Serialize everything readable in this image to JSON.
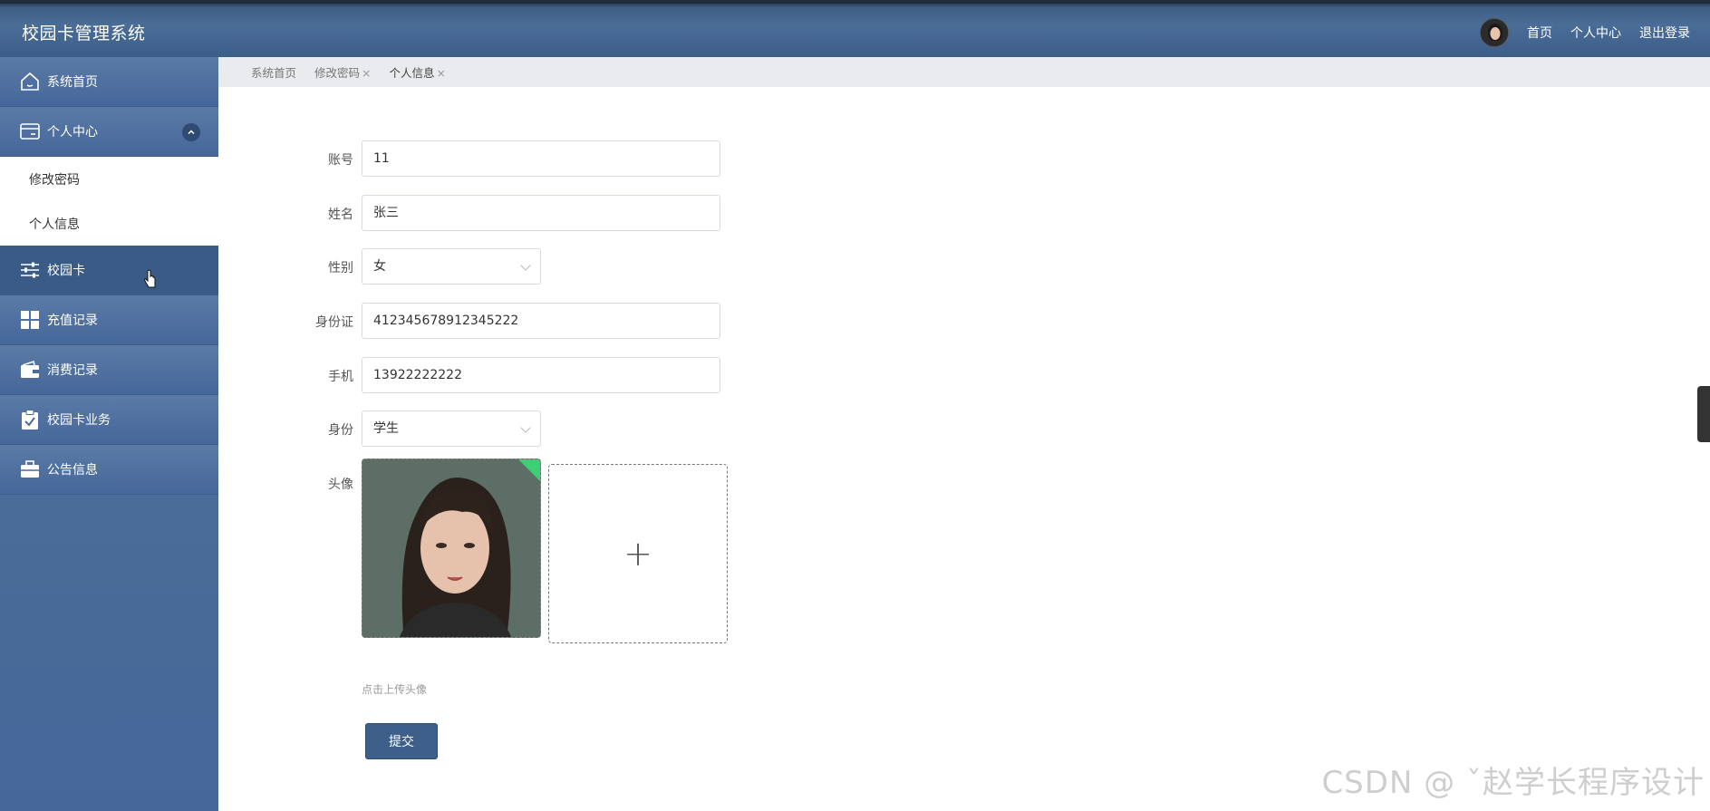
{
  "app": {
    "title": "校园卡管理系统"
  },
  "header": {
    "links": [
      "首页",
      "个人中心",
      "退出登录"
    ]
  },
  "sidebar": {
    "items": [
      {
        "label": "系统首页",
        "icon": "home-icon"
      },
      {
        "label": "个人中心",
        "icon": "card-icon",
        "expanded": true,
        "children": [
          {
            "label": "修改密码"
          },
          {
            "label": "个人信息"
          }
        ]
      },
      {
        "label": "校园卡",
        "icon": "sliders-icon"
      },
      {
        "label": "充值记录",
        "icon": "grid-icon"
      },
      {
        "label": "消费记录",
        "icon": "wallet-icon"
      },
      {
        "label": "校园卡业务",
        "icon": "clipboard-check-icon"
      },
      {
        "label": "公告信息",
        "icon": "briefcase-icon"
      }
    ]
  },
  "tabs": [
    {
      "label": "系统首页",
      "closable": false
    },
    {
      "label": "修改密码",
      "closable": true
    },
    {
      "label": "个人信息",
      "closable": true
    }
  ],
  "tab_close_glyph": "×",
  "form": {
    "account": {
      "label": "账号",
      "value": "11"
    },
    "name": {
      "label": "姓名",
      "value": "张三"
    },
    "gender": {
      "label": "性别",
      "value": "女"
    },
    "id_card": {
      "label": "身份证",
      "value": "412345678912345222"
    },
    "phone": {
      "label": "手机",
      "value": "13922222222"
    },
    "identity": {
      "label": "身份",
      "value": "学生"
    },
    "avatar": {
      "label": "头像",
      "hint": "点击上传头像",
      "plus": "+"
    },
    "submit_label": "提交"
  },
  "watermark": "CSDN @ ˇ赵学长程序设计",
  "colors": {
    "accent": "#3e5f89",
    "header": "#4a6d97",
    "upload_badge": "#3ccf73"
  }
}
